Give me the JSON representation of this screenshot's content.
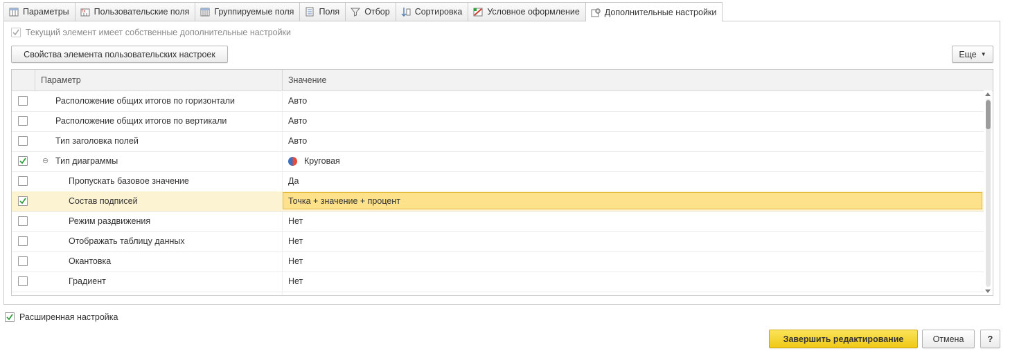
{
  "tabs": [
    {
      "label": "Параметры",
      "icon": "parameters-icon",
      "active": false
    },
    {
      "label": "Пользовательские поля",
      "icon": "user-fields-icon",
      "active": false
    },
    {
      "label": "Группируемые поля",
      "icon": "grouping-fields-icon",
      "active": false
    },
    {
      "label": "Поля",
      "icon": "fields-icon",
      "active": false
    },
    {
      "label": "Отбор",
      "icon": "filter-icon",
      "active": false
    },
    {
      "label": "Сортировка",
      "icon": "sort-icon",
      "active": false
    },
    {
      "label": "Условное оформление",
      "icon": "conditional-format-icon",
      "active": false
    },
    {
      "label": "Дополнительные настройки",
      "icon": "additional-settings-icon",
      "active": true
    }
  ],
  "own_settings": {
    "label": "Текущий элемент имеет собственные дополнительные настройки",
    "checked": true
  },
  "toolbar": {
    "props_button": "Свойства элемента пользовательских настроек",
    "more_button": "Еще"
  },
  "grid": {
    "headers": {
      "param": "Параметр",
      "value": "Значение"
    },
    "rows": [
      {
        "name": "Расположение общих итогов по горизонтали",
        "value": "Авто",
        "checked": false,
        "level": 0
      },
      {
        "name": "Расположение общих итогов по вертикали",
        "value": "Авто",
        "checked": false,
        "level": 0
      },
      {
        "name": "Тип заголовка полей",
        "value": "Авто",
        "checked": false,
        "level": 0
      },
      {
        "name": "Тип диаграммы",
        "value": "Круговая",
        "checked": true,
        "level": 0,
        "group": true,
        "value_icon": "pie-chart-icon"
      },
      {
        "name": "Пропускать базовое значение",
        "value": "Да",
        "checked": false,
        "level": 1
      },
      {
        "name": "Состав подписей",
        "value": "Точка + значение + процент",
        "checked": true,
        "level": 1,
        "selected": true
      },
      {
        "name": "Режим раздвижения",
        "value": "Нет",
        "checked": false,
        "level": 1
      },
      {
        "name": "Отображать таблицу данных",
        "value": "Нет",
        "checked": false,
        "level": 1
      },
      {
        "name": "Окантовка",
        "value": "Нет",
        "checked": false,
        "level": 1
      },
      {
        "name": "Градиент",
        "value": "Нет",
        "checked": false,
        "level": 1
      }
    ]
  },
  "extended": {
    "label": "Расширенная настройка",
    "checked": true
  },
  "footer": {
    "finish": "Завершить редактирование",
    "cancel": "Отмена",
    "help": "?"
  },
  "colors": {
    "accent_yellow": "#f0c916",
    "selection": "#fde28b",
    "check_green": "#2e9e3a"
  }
}
